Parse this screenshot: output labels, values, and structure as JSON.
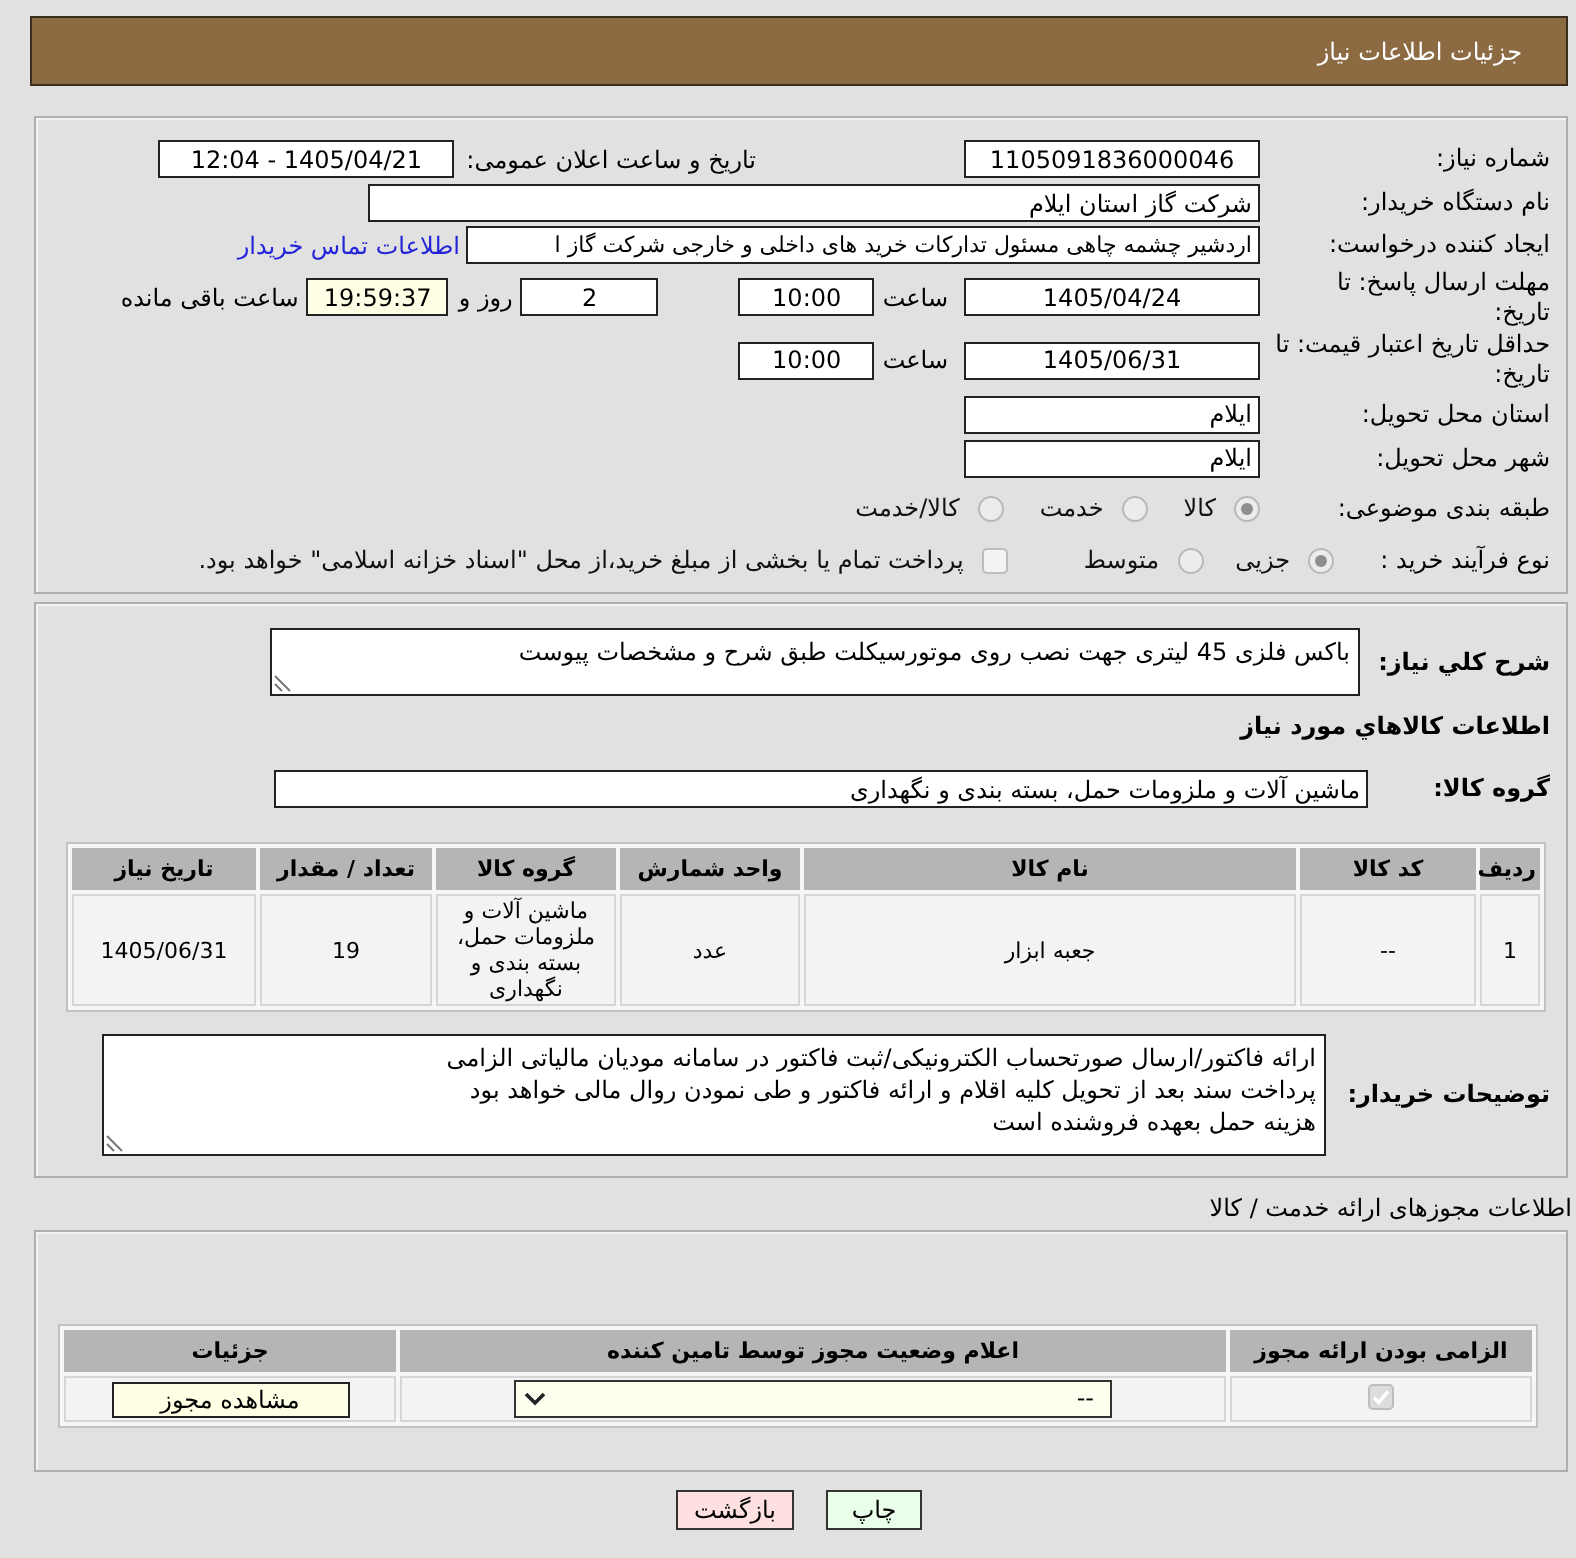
{
  "header": {
    "title": "جزئیات اطلاعات نیاز"
  },
  "details": {
    "need_number": {
      "label": "شماره نیاز:",
      "value": "1105091836000046"
    },
    "announce": {
      "label": "تاریخ و ساعت اعلان عمومی:",
      "value": "1405/04/21 - 12:04"
    },
    "buyer": {
      "label": "نام دستگاه خریدار:",
      "value": "شرکت گاز استان ایلام"
    },
    "requester": {
      "label": "ایجاد کننده درخواست:",
      "value": "اردشیر چشمه چاهی مسئول تدارکات خرید های داخلی و خارجی  شرکت گاز ا",
      "link": "اطلاعات تماس خریدار"
    },
    "response_deadline": {
      "label": "مهلت ارسال پاسخ: تا تاریخ:",
      "date": "1405/04/24",
      "time_label": "ساعت",
      "time": "10:00",
      "days": "2",
      "days_label": "روز و",
      "remaining": "19:59:37",
      "remaining_label": "ساعت باقی مانده"
    },
    "price_validity": {
      "label": "حداقل تاریخ اعتبار قیمت: تا تاریخ:",
      "date": "1405/06/31",
      "time_label": "ساعت",
      "time": "10:00"
    },
    "province": {
      "label": "استان محل تحویل:",
      "value": "ایلام"
    },
    "city": {
      "label": "شهر محل تحویل:",
      "value": "ایلام"
    },
    "category": {
      "label": "طبقه بندی موضوعی:",
      "options": [
        {
          "label": "کالا",
          "selected": true
        },
        {
          "label": "خدمت",
          "selected": false
        },
        {
          "label": "کالا/خدمت",
          "selected": false
        }
      ]
    },
    "process": {
      "label": "نوع فرآیند خرید :",
      "options": [
        {
          "label": "جزیی",
          "selected": true
        },
        {
          "label": "متوسط",
          "selected": false
        }
      ],
      "treasury": {
        "label": "پرداخت تمام یا بخشی از مبلغ خرید،از محل \"اسناد خزانه اسلامی\" خواهد بود.",
        "checked": false
      }
    }
  },
  "need": {
    "summary": {
      "label": "شرح کلي نیاز:",
      "value": "باکس فلزی 45 لیتری جهت نصب روی موتورسیکلت طبق شرح و مشخصات پیوست"
    },
    "goods_heading": "اطلاعات کالاهاي مورد نیاز",
    "goods_group": {
      "label": "گروه کالا:",
      "value": "ماشین آلات و ملزومات حمل، بسته بندی و نگهداری"
    },
    "table": {
      "columns": [
        "ردیف",
        "کد کالا",
        "نام کالا",
        "واحد شمارش",
        "گروه کالا",
        "تعداد / مقدار",
        "تاریخ نیاز"
      ],
      "rows": [
        [
          "1",
          "--",
          "جعبه ابزار",
          "عدد",
          "ماشین آلات و ملزومات حمل، بسته بندی و نگهداری",
          "19",
          "1405/06/31"
        ]
      ]
    },
    "buyer_notes": {
      "label": "توضیحات خریدار:",
      "lines": [
        "ارائه فاکتور/ارسال صورتحساب الکترونیکی/ثبت فاکتور در سامانه مودیان مالیاتی الزامی",
        "پرداخت سند بعد از تحویل کلیه اقلام و ارائه فاکتور و طی نمودن روال مالی خواهد بود",
        "هزینه حمل بعهده فروشنده است"
      ]
    }
  },
  "permits": {
    "heading": "اطلاعات مجوزهای ارائه خدمت / کالا",
    "columns": [
      "الزامی بودن ارائه مجوز",
      "اعلام وضعیت مجوز توسط تامین کننده",
      "جزئیات"
    ],
    "rows": [
      {
        "required": true,
        "status": "--",
        "action": "مشاهده مجوز"
      }
    ]
  },
  "buttons": [
    {
      "label": "چاپ",
      "kind": "print"
    },
    {
      "label": "بازگشت",
      "kind": "back"
    }
  ]
}
